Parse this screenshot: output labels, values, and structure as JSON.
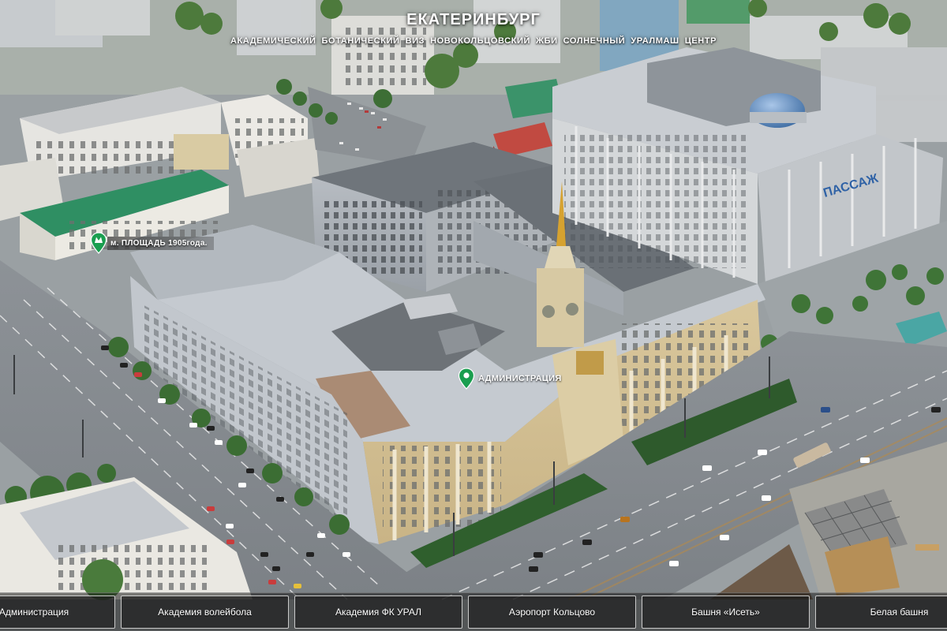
{
  "header": {
    "city": "ЕКАТЕРИНБУРГ",
    "districts": [
      "АКАДЕМИЧЕСКИЙ",
      "БОТАНИЧЕСКИЙ",
      "ВИЗ",
      "НОВОКОЛЬЦОВСКИЙ",
      "ЖБИ",
      "СОЛНЕЧНЫЙ",
      "УРАЛМАШ",
      "ЦЕНТР"
    ]
  },
  "markers": {
    "metro": {
      "label": "м. ПЛОЩАДЬ 1905года.",
      "icon": "metro-pin-icon",
      "color": "#1a9e4f"
    },
    "admin": {
      "label": "АДМИНИСТРАЦИЯ",
      "icon": "location-pin-icon",
      "color": "#1a9e4f"
    }
  },
  "signs": {
    "passage": "ПАССАЖ"
  },
  "nav": {
    "items": [
      "Администрация",
      "Академия волейбола",
      "Академия ФК УРАЛ",
      "Аэропорт Кольцово",
      "Башня «Исеть»",
      "Белая башня"
    ]
  },
  "colors": {
    "accent": "#1a9e4f",
    "nav_border": "#ffffff"
  }
}
